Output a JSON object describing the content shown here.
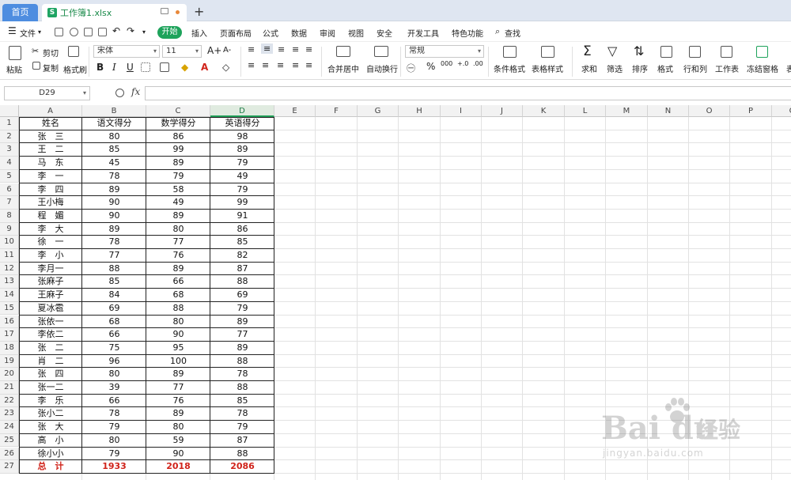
{
  "titlebar": {
    "home_tab": "首页",
    "file_tab": "工作簿1.xlsx",
    "file_icon": "S",
    "new_tab": "+"
  },
  "menu": {
    "file": "文件",
    "items": [
      "开始",
      "插入",
      "页面布局",
      "公式",
      "数据",
      "审阅",
      "视图",
      "安全",
      "开发工具",
      "特色功能"
    ],
    "search": "查找"
  },
  "ribbon": {
    "paste": "粘贴",
    "cut": "剪切",
    "copy": "复制",
    "format_painter": "格式刷",
    "font_name": "宋体",
    "font_size": "11",
    "font_grow": "A+",
    "font_shrink": "A-",
    "bold": "B",
    "italic": "I",
    "underline": "U",
    "merge_center": "合并居中",
    "wrap_text": "自动换行",
    "number_format": "常规",
    "percent": "%",
    "thousands": "000",
    "inc_decimal": "+.0",
    "dec_decimal": ".00",
    "cond_format": "条件格式",
    "table_style": "表格样式",
    "sum": "求和",
    "filter": "筛选",
    "sort": "排序",
    "format": "格式",
    "row_col": "行和列",
    "worksheet": "工作表",
    "freeze": "冻结窗格",
    "more": "表"
  },
  "formula_bar": {
    "cell_ref": "D29",
    "fx": "fx",
    "value": ""
  },
  "columns": [
    "A",
    "B",
    "C",
    "D",
    "E",
    "F",
    "G",
    "H",
    "I",
    "J",
    "K",
    "L",
    "M",
    "N",
    "O",
    "P",
    "Q"
  ],
  "rows": [
    "1",
    "2",
    "3",
    "4",
    "5",
    "6",
    "7",
    "8",
    "9",
    "10",
    "11",
    "12",
    "13",
    "14",
    "15",
    "16",
    "17",
    "18",
    "19",
    "20",
    "21",
    "22",
    "23",
    "24",
    "25",
    "26",
    "27"
  ],
  "table": {
    "headers": [
      "姓名",
      "语文得分",
      "数学得分",
      "英语得分"
    ],
    "data": [
      [
        "张　三",
        "80",
        "86",
        "98"
      ],
      [
        "王　二",
        "85",
        "99",
        "89"
      ],
      [
        "马　东",
        "45",
        "89",
        "79"
      ],
      [
        "李　一",
        "78",
        "79",
        "49"
      ],
      [
        "李　四",
        "89",
        "58",
        "79"
      ],
      [
        "王小梅",
        "90",
        "49",
        "99"
      ],
      [
        "程　媚",
        "90",
        "89",
        "91"
      ],
      [
        "李　大",
        "89",
        "80",
        "86"
      ],
      [
        "徐　一",
        "78",
        "77",
        "85"
      ],
      [
        "李　小",
        "77",
        "76",
        "82"
      ],
      [
        "李月一",
        "88",
        "89",
        "87"
      ],
      [
        "张麻子",
        "85",
        "66",
        "88"
      ],
      [
        "王麻子",
        "84",
        "68",
        "69"
      ],
      [
        "夏冰雹",
        "69",
        "88",
        "79"
      ],
      [
        "张依一",
        "68",
        "80",
        "89"
      ],
      [
        "李依二",
        "66",
        "90",
        "77"
      ],
      [
        "张　二",
        "75",
        "95",
        "89"
      ],
      [
        "肖　二",
        "96",
        "100",
        "88"
      ],
      [
        "张　四",
        "80",
        "89",
        "78"
      ],
      [
        "张一二",
        "39",
        "77",
        "88"
      ],
      [
        "李　乐",
        "66",
        "76",
        "85"
      ],
      [
        "张小二",
        "78",
        "89",
        "78"
      ],
      [
        "张　大",
        "79",
        "80",
        "79"
      ],
      [
        "高　小",
        "80",
        "59",
        "87"
      ],
      [
        "徐小小",
        "79",
        "90",
        "88"
      ]
    ],
    "total": [
      "总　计",
      "1933",
      "2018",
      "2086"
    ]
  },
  "watermark": {
    "brand": "Bai du",
    "cn": "经验",
    "url": "jingyan.baidu.com"
  },
  "colors": {
    "accent_green": "#1ea35b",
    "home_tab_blue": "#4e8de0",
    "total_red": "#d0231a"
  }
}
